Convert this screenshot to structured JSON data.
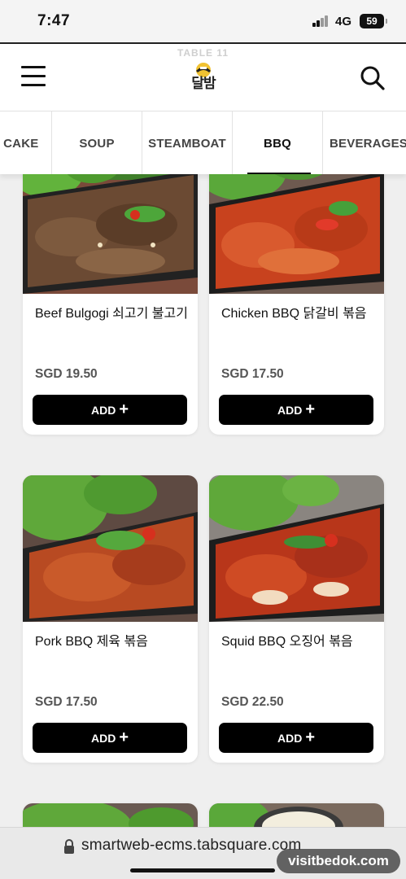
{
  "status_bar": {
    "time": "7:47",
    "network": "4G",
    "battery": "59"
  },
  "header": {
    "table_label": "TABLE 11",
    "icons": {
      "menu": "hamburger-menu-icon",
      "search": "search-icon",
      "logo": "restaurant-logo"
    }
  },
  "tabs": [
    {
      "label": "E CAKE"
    },
    {
      "label": "SOUP"
    },
    {
      "label": "STEAMBOAT"
    },
    {
      "label": "BBQ",
      "active": true
    },
    {
      "label": "BEVERAGES"
    }
  ],
  "menu_items": [
    {
      "name": "Beef Bulgogi 쇠고기 불고기",
      "price": "SGD 19.50",
      "add_label": "ADD",
      "photo": "beef"
    },
    {
      "name": "Chicken BBQ 닭갈비 볶음",
      "price": "SGD 17.50",
      "add_label": "ADD",
      "photo": "chicken"
    },
    {
      "name": "Pork BBQ 제육 볶음",
      "price": "SGD 17.50",
      "add_label": "ADD",
      "photo": "pork"
    },
    {
      "name": "Squid BBQ 오징어 볶음",
      "price": "SGD 22.50",
      "add_label": "ADD",
      "photo": "squid"
    }
  ],
  "browser": {
    "url": "smartweb-ecms.tabsquare.com"
  },
  "watermark": "visitbedok.com",
  "colors": {
    "background": "#efefef",
    "button": "#000000",
    "lettuce": "#5fa83a",
    "beef_sauce": "#6b4a33",
    "spicy_sauce": "#c8421e"
  }
}
